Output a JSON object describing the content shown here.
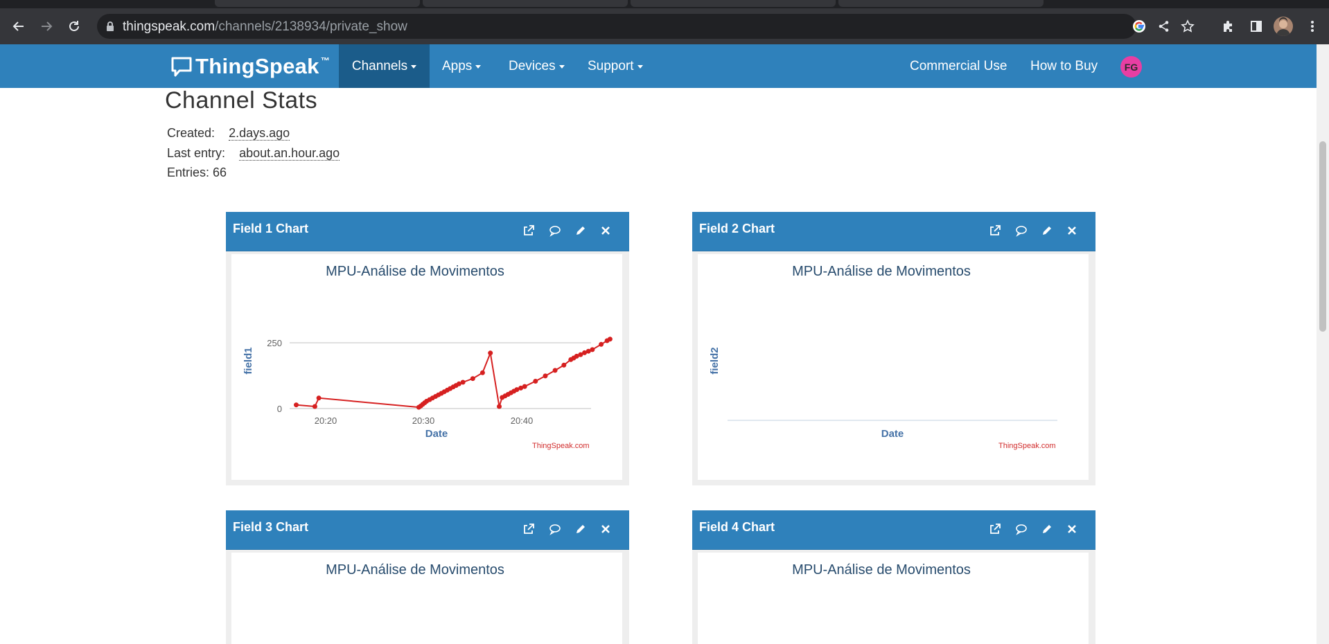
{
  "browser": {
    "url_host": "thingspeak.com",
    "url_path": "/channels/2138934/private_show"
  },
  "navbar": {
    "brand": "ThingSpeak",
    "brand_tm": "™",
    "items": [
      {
        "label": "Channels"
      },
      {
        "label": "Apps"
      },
      {
        "label": "Devices"
      },
      {
        "label": "Support"
      }
    ],
    "right_items": [
      {
        "label": "Commercial Use"
      },
      {
        "label": "How to Buy"
      }
    ],
    "avatar_initials": "FG",
    "avatar_color": "#e83ea3",
    "brand_color": "#2f81bb"
  },
  "stats": {
    "title": "Channel Stats",
    "created_label": "Created:",
    "created_value": "2.days.ago",
    "last_entry_label": "Last entry:",
    "last_entry_value": "about.an.hour.ago",
    "entries_label": "Entries: 66"
  },
  "widgets": [
    {
      "title": "Field 1 Chart",
      "chart_title": "MPU-Análise de Movimentos",
      "ylabel": "field1",
      "xlabel": "Date",
      "credits": "ThingSpeak.com"
    },
    {
      "title": "Field 2 Chart",
      "chart_title": "MPU-Análise de Movimentos",
      "ylabel": "field2",
      "xlabel": "Date",
      "credits": "ThingSpeak.com"
    },
    {
      "title": "Field 3 Chart",
      "chart_title": "MPU-Análise de Movimentos"
    },
    {
      "title": "Field 4 Chart",
      "chart_title": "MPU-Análise de Movimentos"
    }
  ],
  "widget_icons": [
    "external-link-icon",
    "comment-icon",
    "pencil-icon",
    "close-icon"
  ],
  "chart_data": [
    {
      "type": "line",
      "title": "MPU-Análise de Movimentos",
      "xlabel": "Date",
      "ylabel": "field1",
      "x_ticks": [
        "20:20",
        "20:30",
        "20:40"
      ],
      "y_ticks": [
        0,
        250
      ],
      "ylim": [
        0,
        420
      ],
      "x_unit": "minutes after 20:00",
      "xlim": [
        16.3,
        52.0
      ],
      "color": "#d62020",
      "grid": true,
      "legend": "none",
      "x": [
        17.0,
        18.9,
        19.3,
        29.5,
        29.7,
        29.9,
        30.1,
        30.3,
        30.6,
        30.9,
        31.2,
        31.5,
        31.8,
        32.1,
        32.4,
        32.7,
        33.0,
        33.3,
        33.6,
        34.0,
        35.0,
        36.0,
        36.8,
        37.7,
        38.0,
        38.3,
        38.6,
        38.9,
        39.2,
        39.5,
        39.9,
        40.3,
        41.4,
        42.4,
        43.4,
        44.3,
        45.0,
        45.3,
        45.6,
        46.0,
        46.4,
        46.8,
        47.2,
        48.1,
        48.7,
        49.0
      ],
      "values": [
        14,
        8,
        40,
        5,
        10,
        16,
        22,
        28,
        34,
        40,
        46,
        52,
        58,
        64,
        70,
        76,
        82,
        88,
        94,
        100,
        114,
        136,
        211,
        8,
        42,
        48,
        54,
        60,
        66,
        72,
        78,
        84,
        104,
        124,
        145,
        165,
        186,
        192,
        199,
        205,
        212,
        218,
        224,
        244,
        258,
        264
      ]
    },
    {
      "type": "line",
      "title": "MPU-Análise de Movimentos",
      "xlabel": "Date",
      "ylabel": "field2",
      "series": []
    }
  ]
}
